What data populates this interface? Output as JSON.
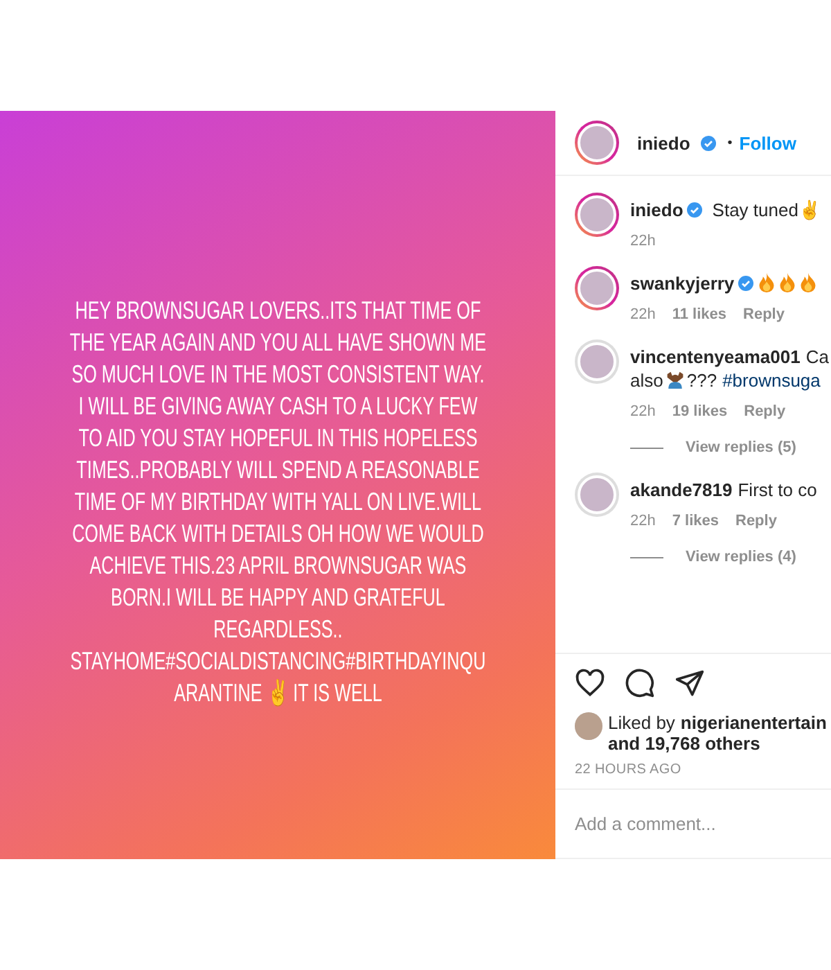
{
  "post": {
    "lines": [
      "HEY BROWNSUGAR LOVERS..ITS THAT TIME OF",
      "THE YEAR AGAIN AND YOU ALL HAVE SHOWN ME",
      "SO MUCH LOVE IN THE MOST CONSISTENT WAY.",
      "I WILL BE GIVING AWAY CASH TO A LUCKY FEW",
      "TO AID YOU STAY HOPEFUL IN THIS HOPELESS",
      "TIMES..PROBABLY WILL SPEND A REASONABLE",
      "TIME OF MY BIRTHDAY WITH YALL ON LIVE.WILL",
      "COME BACK WITH DETAILS OH HOW WE WOULD",
      "ACHIEVE THIS.23 APRIL BROWNSUGAR WAS",
      "BORN.I WILL BE HAPPY AND GRATEFUL",
      "REGARDLESS..",
      "STAYHOME#SOCIALDISTANCING#BIRTHDAYINQU",
      "ARANTINE ✌ IT IS WELL"
    ]
  },
  "header": {
    "username": "iniedo",
    "verified": true,
    "story_ring": true,
    "separator": "•",
    "follow": "Follow"
  },
  "comments": [
    {
      "username": "iniedo",
      "verified": true,
      "story_ring": true,
      "parts": [
        {
          "kind": "text",
          "text": "Stay tuned✌"
        }
      ],
      "time": "22h"
    },
    {
      "username": "swankyjerry",
      "verified": true,
      "story_ring": true,
      "parts": [
        {
          "kind": "fire"
        },
        {
          "kind": "fire"
        },
        {
          "kind": "fire"
        }
      ],
      "time": "22h",
      "likes": "11 likes",
      "reply": "Reply"
    },
    {
      "username": "vincentenyeama001",
      "verified": false,
      "story_ring": false,
      "parts": [
        {
          "kind": "text",
          "text": "Ca"
        },
        {
          "kind": "break"
        },
        {
          "kind": "text",
          "text": "also"
        },
        {
          "kind": "person"
        },
        {
          "kind": "text",
          "text": "???"
        },
        {
          "kind": "tag",
          "text": "#brownsuga"
        }
      ],
      "time": "22h",
      "likes": "19 likes",
      "reply": "Reply",
      "view_replies": "View replies (5)"
    },
    {
      "username": "akande7819",
      "verified": false,
      "story_ring": false,
      "parts": [
        {
          "kind": "text",
          "text": "First to co"
        }
      ],
      "time": "22h",
      "likes": "7 likes",
      "reply": "Reply",
      "view_replies": "View replies (4)"
    }
  ],
  "liked_by": {
    "prefix": "Liked by",
    "user": "nigerianentertain",
    "rest": "and 19,768 others"
  },
  "timestamp": "22 HOURS AGO",
  "comment_field": {
    "placeholder": "Add a comment..."
  }
}
